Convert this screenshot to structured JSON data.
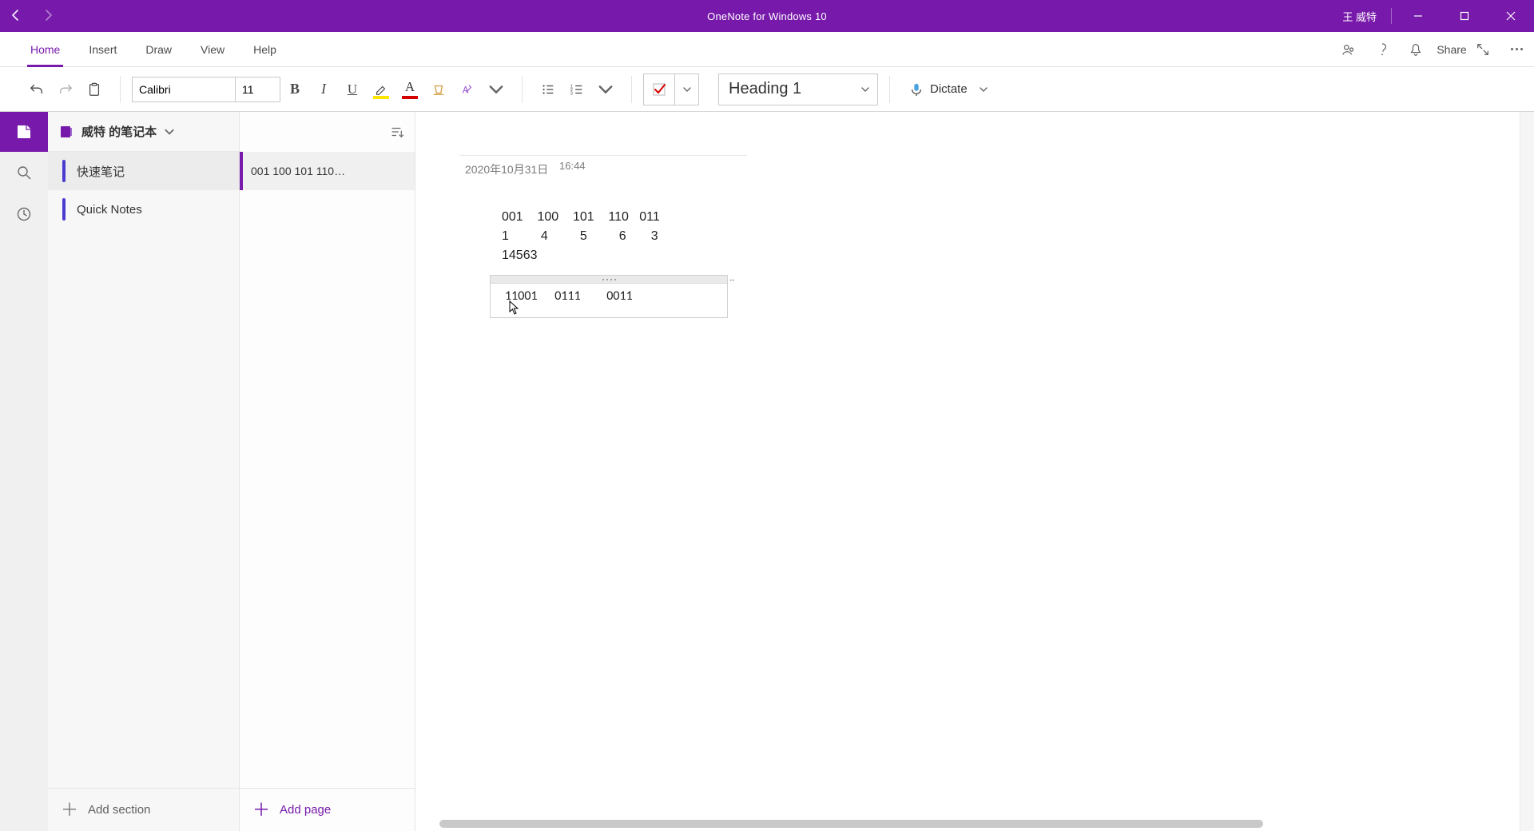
{
  "titlebar": {
    "app_title": "OneNote for Windows 10",
    "user_name": "王 威特"
  },
  "ribbon": {
    "tabs": [
      {
        "label": "Home",
        "active": true
      },
      {
        "label": "Insert",
        "active": false
      },
      {
        "label": "Draw",
        "active": false
      },
      {
        "label": "View",
        "active": false
      },
      {
        "label": "Help",
        "active": false
      }
    ],
    "share_label": "Share"
  },
  "toolbar": {
    "font_name": "Calibri",
    "font_size": "11",
    "highlight_color": "#ffe600",
    "font_color": "#d40000",
    "style_name": "Heading 1",
    "dictate_label": "Dictate",
    "todo_color": "#d40000"
  },
  "notebook": {
    "name": "威特 的笔记本",
    "sections": [
      {
        "label": "快速笔记",
        "color": "#4b3bd1",
        "active": true
      },
      {
        "label": "Quick Notes",
        "color": "#4b3bd1",
        "active": false
      }
    ],
    "add_section_label": "Add section"
  },
  "pages": {
    "items": [
      {
        "label": "001    100    101    110…",
        "active": true
      }
    ],
    "add_page_label": "Add page"
  },
  "note": {
    "date": "2020年10月31日",
    "time": "16:44",
    "block1_line1": "001    100    101    110   011",
    "block1_line2": "1         4         5         6       3",
    "block1_line3": "14563",
    "block2_line1": "11001      0111         0011"
  }
}
